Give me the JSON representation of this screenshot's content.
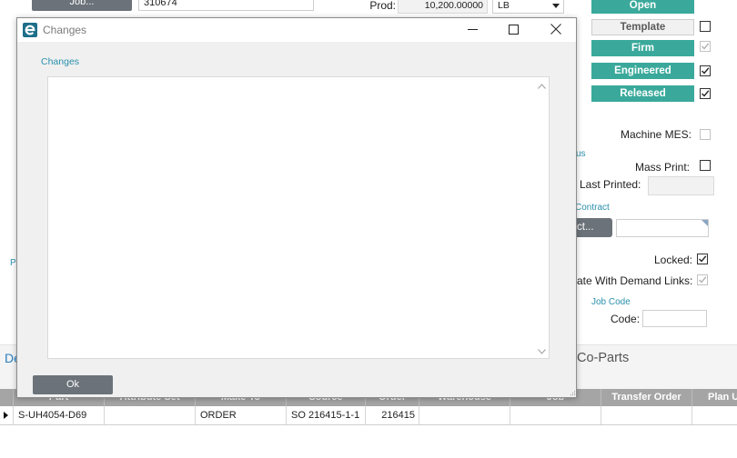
{
  "job_header": {
    "job_button": "Job...",
    "job_number": "310674",
    "prod_label": "Prod:",
    "prod_qty": "10,200.00000",
    "uom": "LB"
  },
  "status": {
    "open": {
      "label": "Open"
    },
    "template": {
      "label": "Template",
      "checked": false
    },
    "firm": {
      "label": "Firm",
      "checked": true
    },
    "engineered": {
      "label": "Engineered",
      "checked": true
    },
    "released": {
      "label": "Released",
      "checked": true
    }
  },
  "side_panel": {
    "machine_mes": {
      "label": "Machine MES:",
      "checked": false
    },
    "partial_group_label": "us",
    "mass_print": {
      "label": "Mass Print:",
      "checked": false
    },
    "last_printed": {
      "label": "Last Printed:",
      "value": ""
    },
    "contract": {
      "group_label": "Contract",
      "button": "ct...",
      "value": ""
    },
    "locked": {
      "label": "Locked:",
      "checked": true
    },
    "demand_links": {
      "label": "ate With Demand Links:",
      "checked": true
    },
    "job_code": {
      "group_label": "Job Code",
      "code_label": "Code:",
      "code_value": ""
    }
  },
  "left_panel": {
    "partial_label": "P"
  },
  "tabs": [
    {
      "label": "De",
      "selected": true
    },
    {
      "label": "Co-Parts",
      "selected": false
    }
  ],
  "grid": {
    "columns": [
      "Part",
      "Attribute Set",
      "Make To",
      "Source",
      "Order",
      "Warehouse",
      "Job",
      "Transfer Order",
      "Plan U"
    ],
    "rows": [
      [
        "S-UH4054-D69",
        "",
        "ORDER",
        "SO 216415-1-1",
        "216415",
        "",
        "",
        "",
        ""
      ]
    ]
  },
  "dialog": {
    "title": "Changes",
    "app_icon": {
      "name": "epicor-e-icon",
      "logo_letter": "e"
    },
    "field_label": "Changes",
    "changes_text": "",
    "ok_button": "Ok"
  },
  "icons": {
    "app": "epicor-e-icon",
    "minimize": "minimize-icon",
    "maximize": "maximize-icon",
    "close": "close-icon",
    "scroll_up": "chevron-up-icon",
    "scroll_down": "chevron-down-icon",
    "uom_dropdown": "dropdown-arrow-icon",
    "row_indicator": "row-selector-icon",
    "resize_grip": "resize-grip-icon",
    "check": "check-mark-icon"
  },
  "colors": {
    "status_teal": "#3aa99b",
    "dark_button": "#6b7279",
    "link_teal": "#2a90ad",
    "grid_header": "#a5a5a5",
    "selected_tab": "#2a7fc0",
    "logo": "#1d6f8a"
  }
}
